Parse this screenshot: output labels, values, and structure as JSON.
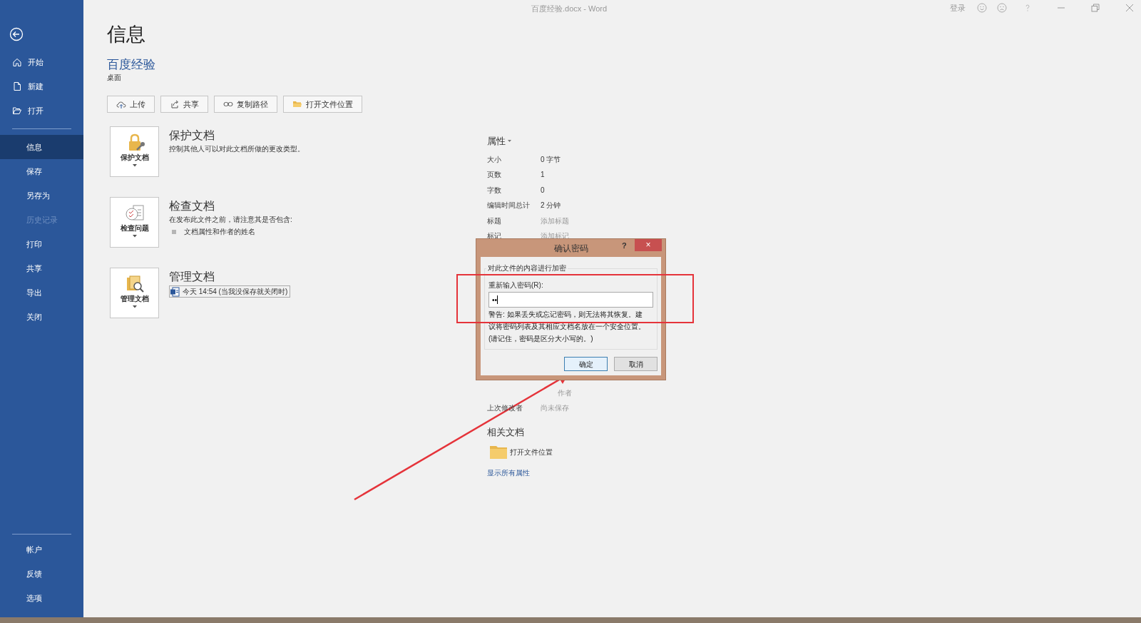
{
  "window": {
    "title": "百度经验.docx  -  Word",
    "sign_in": "登录"
  },
  "sidebar": {
    "file_items": [
      {
        "label": "开始"
      },
      {
        "label": "新建"
      },
      {
        "label": "打开"
      }
    ],
    "nav_items": [
      {
        "label": "信息",
        "selected": true,
        "disabled": false
      },
      {
        "label": "保存",
        "selected": false,
        "disabled": false
      },
      {
        "label": "另存为",
        "selected": false,
        "disabled": false
      },
      {
        "label": "历史记录",
        "selected": false,
        "disabled": true
      },
      {
        "label": "打印",
        "selected": false,
        "disabled": false
      },
      {
        "label": "共享",
        "selected": false,
        "disabled": false
      },
      {
        "label": "导出",
        "selected": false,
        "disabled": false
      },
      {
        "label": "关闭",
        "selected": false,
        "disabled": false
      }
    ],
    "bottom_items": [
      {
        "label": "帐户"
      },
      {
        "label": "反馈"
      },
      {
        "label": "选项"
      }
    ]
  },
  "page": {
    "heading": "信息",
    "doc_name": "百度经验",
    "location": "桌面",
    "actions": [
      {
        "label": "上传"
      },
      {
        "label": "共享"
      },
      {
        "label": "复制路径"
      },
      {
        "label": "打开文件位置"
      }
    ],
    "sections": [
      {
        "button": "保护文档",
        "title": "保护文档",
        "lines": [
          "控制其他人可以对此文档所做的更改类型。"
        ]
      },
      {
        "button": "检查问题",
        "title": "检查文档",
        "lines": [
          "在发布此文件之前，请注意其是否包含:"
        ],
        "bullets": [
          "文档属性和作者的姓名"
        ]
      },
      {
        "button": "管理文档",
        "title": "管理文档",
        "versions": [
          "今天 14:54 (当我没保存就关闭时)"
        ]
      }
    ]
  },
  "properties": {
    "heading": "属性",
    "rows": [
      {
        "label": "大小",
        "value": "0 字节",
        "placeholder": false
      },
      {
        "label": "页数",
        "value": "1",
        "placeholder": false
      },
      {
        "label": "字数",
        "value": "0",
        "placeholder": false
      },
      {
        "label": "编辑时间总计",
        "value": "2 分钟",
        "placeholder": false
      },
      {
        "label": "标题",
        "value": "添加标题",
        "placeholder": true
      },
      {
        "label": "标记",
        "value": "添加标记",
        "placeholder": true
      }
    ],
    "rows_below": [
      {
        "value": "作者",
        "placeholder": true
      },
      {
        "label": "上次修改者",
        "value": "尚未保存",
        "placeholder": true
      }
    ],
    "related_heading": "相关文档",
    "open_location": "打开文件位置",
    "show_all": "显示所有属性"
  },
  "dialog": {
    "title": "确认密码",
    "help": "?",
    "close": "×",
    "group": "对此文件的内容进行加密",
    "field_label": "重新输入密码(R):",
    "value": "••",
    "warning": "警告: 如果丢失或忘记密码，则无法将其恢复。建议将密码列表及其相应文档名放在一个安全位置。(请记住，密码是区分大小写的。)",
    "buttons": [
      {
        "label": "确定",
        "default": true
      },
      {
        "label": "取消",
        "default": false
      }
    ]
  }
}
